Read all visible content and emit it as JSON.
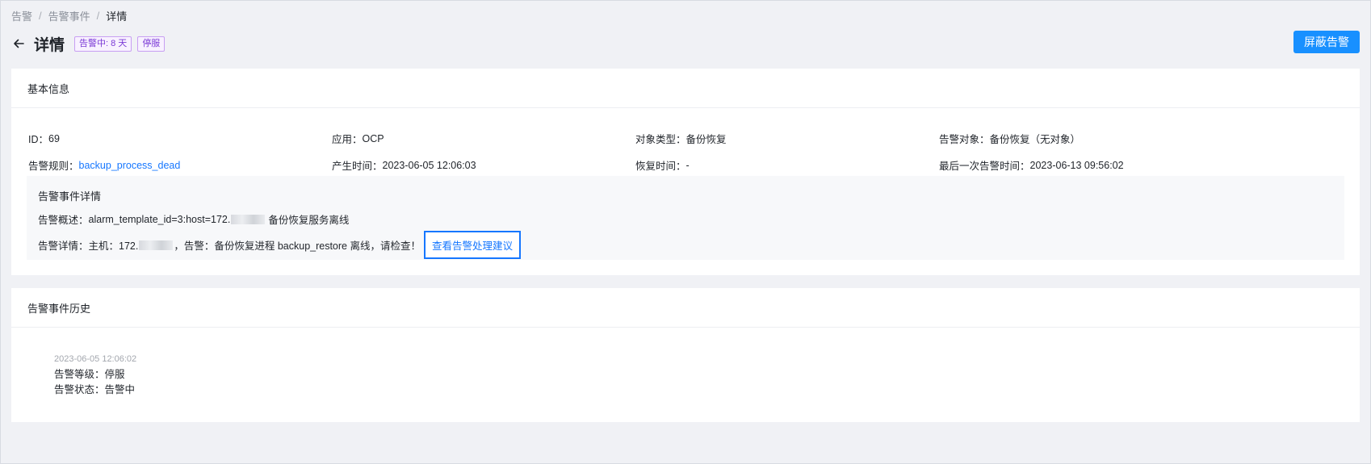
{
  "breadcrumb": {
    "items": [
      "告警",
      "告警事件"
    ],
    "separator": "/",
    "current": "详情"
  },
  "header": {
    "title": "详情",
    "tags": [
      "告警中: 8 天",
      "停服"
    ],
    "action_label": "屏蔽告警",
    "accent": "#1890ff"
  },
  "basic_info": {
    "section_title": "基本信息",
    "rows": [
      [
        {
          "label": "ID：",
          "value": "69",
          "link": false
        },
        {
          "label": "应用：",
          "value": "OCP",
          "link": false
        },
        {
          "label": "对象类型：",
          "value": "备份恢复",
          "link": false
        },
        {
          "label": "告警对象：",
          "value": "备份恢复（无对象）",
          "link": false
        }
      ],
      [
        {
          "label": "告警规则：",
          "value": "backup_process_dead",
          "link": true
        },
        {
          "label": "产生时间：",
          "value": "2023-06-05 12:06:03",
          "link": false
        },
        {
          "label": "恢复时间：",
          "value": "-",
          "link": false
        },
        {
          "label": "最后一次告警时间：",
          "value": "2023-06-13 09:56:02",
          "link": false
        }
      ]
    ],
    "event_detail": {
      "title": "告警事件详情",
      "summary_label": "告警概述：",
      "summary_prefix": "alarm_template_id=3:host=172.",
      "summary_suffix": "备份恢复服务离线",
      "detail_label": "告警详情：",
      "detail_prefix": "主机：172.",
      "detail_suffix": "，告警：备份恢复进程 backup_restore 离线，请检查！",
      "advice_link": "查看告警处理建议"
    }
  },
  "history": {
    "section_title": "告警事件历史",
    "entries": [
      {
        "time": "2023-06-05 12:06:02",
        "level": "告警等级：停服",
        "status": "告警状态：告警中"
      }
    ]
  }
}
